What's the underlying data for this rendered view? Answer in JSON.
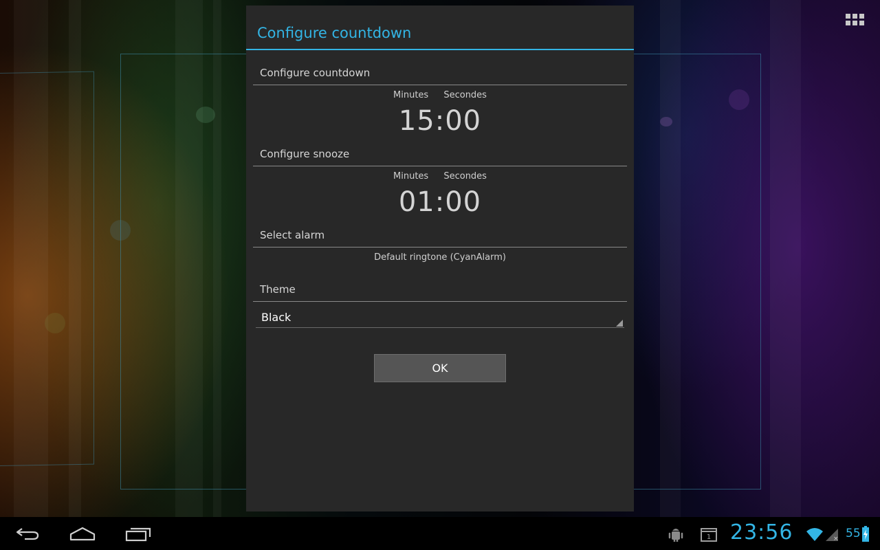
{
  "dialog": {
    "title": "Configure countdown",
    "countdown": {
      "header": "Configure countdown",
      "minutes_label": "Minutes",
      "seconds_label": "Secondes",
      "value": "15:00"
    },
    "snooze": {
      "header": "Configure snooze",
      "minutes_label": "Minutes",
      "seconds_label": "Secondes",
      "value": "01:00"
    },
    "alarm": {
      "header": "Select alarm",
      "value": "Default ringtone (CyanAlarm)"
    },
    "theme": {
      "header": "Theme",
      "selected": "Black"
    },
    "ok_label": "OK"
  },
  "status_bar": {
    "clock": "23:56",
    "battery": "55"
  },
  "colors": {
    "accent": "#33b5e5",
    "dialog_bg": "#282828"
  },
  "icons": {
    "apps": "apps-grid-icon",
    "back": "back-icon",
    "home": "home-icon",
    "recents": "recent-apps-icon",
    "debug": "android-debug-icon",
    "calendar": "calendar-notification-icon",
    "wifi": "wifi-icon",
    "signal": "signal-icon",
    "battery": "battery-charging-icon"
  }
}
